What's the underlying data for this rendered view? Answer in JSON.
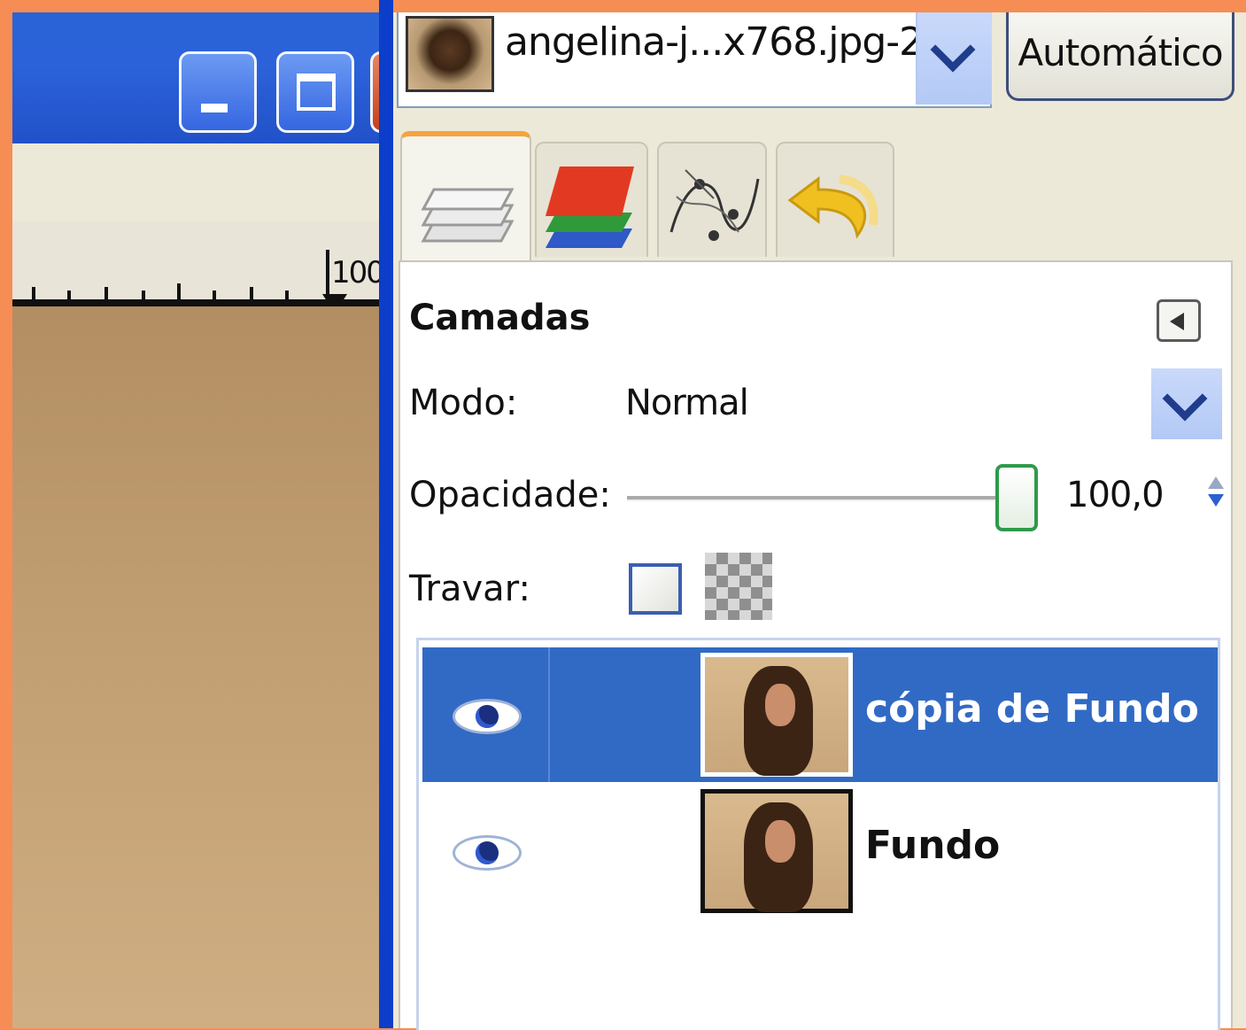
{
  "image_window": {
    "ruler_label": "100"
  },
  "dock": {
    "image_selector": {
      "name": "angelina-j...x768.jpg-2",
      "auto_button": "Automático"
    },
    "tabs": [
      {
        "icon": "layers-icon"
      },
      {
        "icon": "channels-icon"
      },
      {
        "icon": "paths-icon"
      },
      {
        "icon": "undo-icon"
      }
    ],
    "layers": {
      "title": "Camadas",
      "mode_label": "Modo:",
      "mode_value": "Normal",
      "opacity_label": "Opacidade:",
      "opacity_value": "100,0",
      "opacity_fraction": 1.0,
      "lock_label": "Travar:",
      "items": [
        {
          "name": "cópia de Fundo",
          "visible": true,
          "selected": true
        },
        {
          "name": "Fundo",
          "visible": true,
          "selected": false
        }
      ]
    }
  },
  "colors": {
    "selection": "#316ac5",
    "titlebar": "#2a63d6",
    "background": "#f68d55"
  }
}
